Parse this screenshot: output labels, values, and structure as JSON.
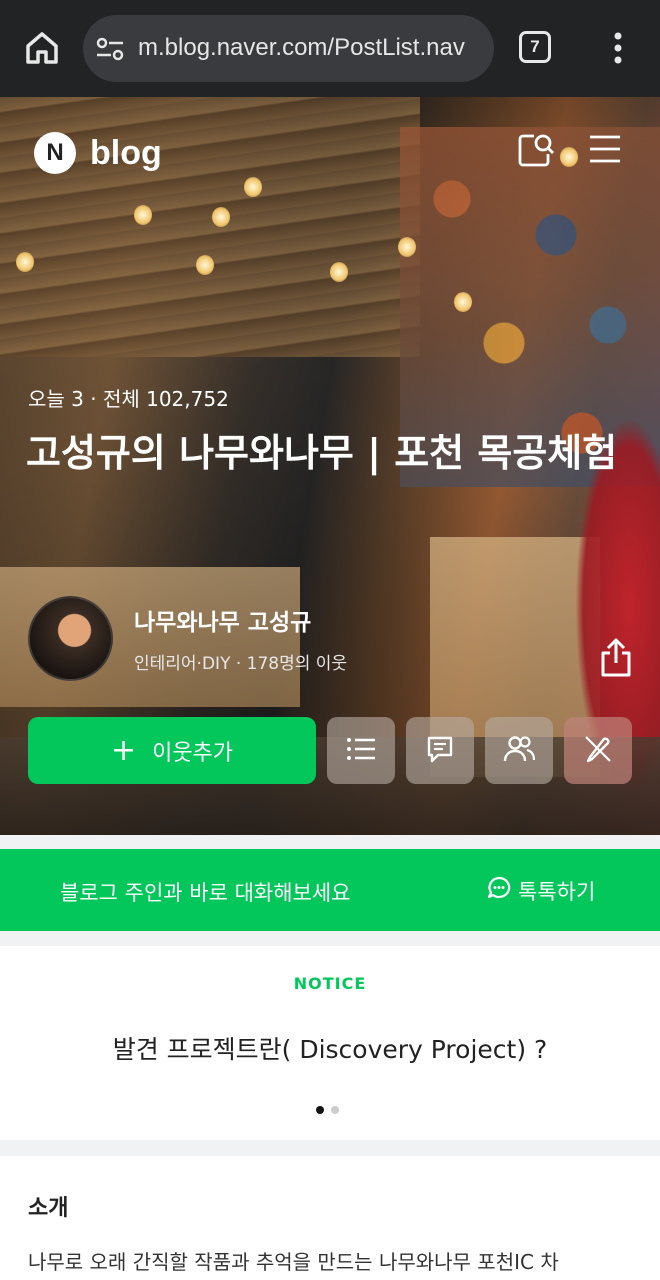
{
  "browser": {
    "url": "m.blog.naver.com/PostList.nav",
    "tab_count": "7",
    "icons": [
      "home-icon",
      "site-settings-icon",
      "tab-switcher-icon",
      "more-vert-icon"
    ]
  },
  "header": {
    "logo_letter": "N",
    "logo_word": "blog",
    "icons": [
      "search-icon",
      "menu-icon"
    ]
  },
  "blog": {
    "stats": "오늘 3  ·  전체 102,752",
    "title": "고성규의 나무와나무 | 포천 목공체험",
    "owner_name": "나무와나무 고성규",
    "meta": "인테리어·DIY · 178명의 이웃",
    "add_neighbor_label": "이웃추가",
    "action_icons": [
      "list-icon",
      "comment-icon",
      "neighbors-icon",
      "write-icon"
    ],
    "share_icon": "share-icon"
  },
  "talk": {
    "message": "블로그 주인과 바로 대화해보세요",
    "button_label": "톡톡하기"
  },
  "notice": {
    "tag": "NOTICE",
    "headline": "발견 프로젝트란( Discovery Project) ?",
    "page_index": 1,
    "page_total": 2
  },
  "intro": {
    "heading": "소개",
    "text": "나무로 오래 간직할 작품과 추억을 만드는 나무와나무 포천IC 차"
  },
  "colors": {
    "brand_green": "#03c75a",
    "chrome_bg": "#222325"
  }
}
